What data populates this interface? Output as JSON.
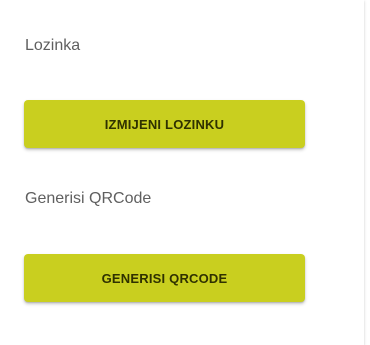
{
  "colors": {
    "button_background": "#c9cf1f",
    "button_text": "#2f3100",
    "label_text": "#5f5f5f",
    "page_background": "#ffffff"
  },
  "password_section": {
    "label": "Lozinka",
    "button_label": "IZMIJENI LOZINKU"
  },
  "qrcode_section": {
    "label": "Generisi QRCode",
    "button_label": "GENERISI QRCODE"
  }
}
